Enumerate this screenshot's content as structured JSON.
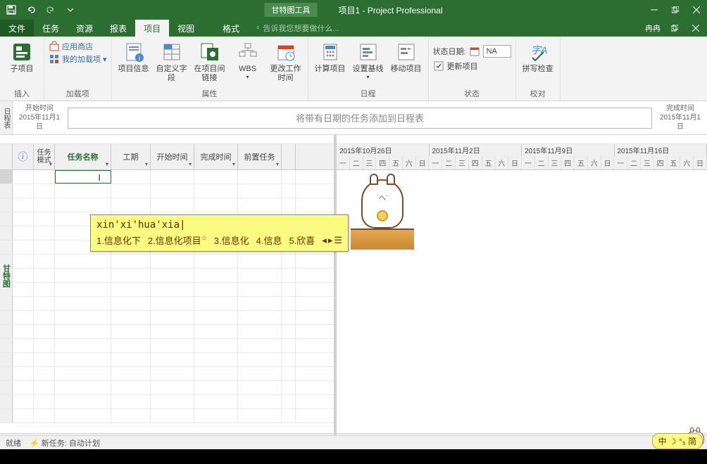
{
  "titlebar": {
    "contextual": "甘特图工具",
    "title": "项目1 - Project Professional"
  },
  "menu": {
    "file": "文件",
    "task": "任务",
    "resource": "资源",
    "report": "报表",
    "project": "项目",
    "view": "视图",
    "format": "格式",
    "tell_me": "告诉我您想要做什么...",
    "user": "冉冉"
  },
  "ribbon": {
    "subproject": "子项目",
    "store": "应用商店",
    "my_addins": "我的加载项",
    "addins_group": "加载项",
    "insert_group": "插入",
    "proj_info": "项目信息",
    "custom_fields": "自定义字段",
    "links": "在项目间链接",
    "wbs": "WBS",
    "change_time": "更改工作时间",
    "props_group": "属性",
    "calc": "计算项目",
    "baseline": "设置基线",
    "move": "移动项目",
    "schedule_group": "日程",
    "status_date_lbl": "状态日期:",
    "status_date_val": "NA",
    "update_project": "更新项目",
    "status_group": "状态",
    "spell": "拼写检查",
    "proof_group": "校对"
  },
  "timeline": {
    "tab": "日程表",
    "start_lbl": "开始时间",
    "start_val": "2015年11月1日",
    "end_lbl": "完成时间",
    "end_val": "2015年11月1日",
    "placeholder": "将带有日期的任务添加到日程表"
  },
  "grid": {
    "side_tab": "甘特图",
    "cols": {
      "info": "",
      "mode": "任务模式",
      "name": "任务名称",
      "duration": "工期",
      "start": "开始时间",
      "finish": "完成时间",
      "pred": "前置任务"
    }
  },
  "gantt": {
    "weeks": [
      "2015年10月26日",
      "2015年11月2日",
      "2015年11月9日",
      "2015年11月16日"
    ],
    "days": [
      "一",
      "二",
      "三",
      "四",
      "五",
      "六",
      "日"
    ]
  },
  "ime": {
    "raw": "xin'xi'hua'xia|",
    "cands": [
      "1.信息化下",
      "2.信息化项目",
      "3.信息化",
      "4.信息",
      "5.欣喜"
    ]
  },
  "statusbar": {
    "ready": "就绪",
    "new_task": "新任务: 自动计划"
  },
  "ime_indicator": "中 ☽ °₅ 简"
}
